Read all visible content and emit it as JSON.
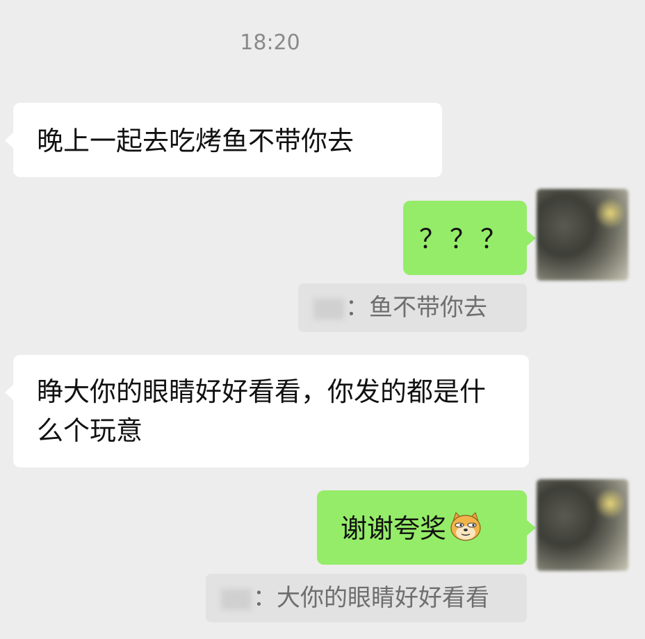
{
  "chat": {
    "timestamp": "18:20",
    "messages": [
      {
        "from": "other",
        "text": "晚上一起去吃烤鱼不带你去"
      },
      {
        "from": "me",
        "text": "？？？",
        "quote": {
          "sep": "：",
          "text": "鱼不带你去"
        }
      },
      {
        "from": "other",
        "text": "睁大你的眼睛好好看看，你发的都是什么个玩意"
      },
      {
        "from": "me",
        "text": "谢谢夸奖",
        "emoji": "doge-emoji",
        "quote": {
          "sep": "：",
          "text": "大你的眼睛好好看看"
        }
      }
    ]
  },
  "colors": {
    "background": "#ededed",
    "incoming_bubble": "#ffffff",
    "outgoing_bubble": "#95ec69",
    "quote_box": "#e2e2e2"
  }
}
